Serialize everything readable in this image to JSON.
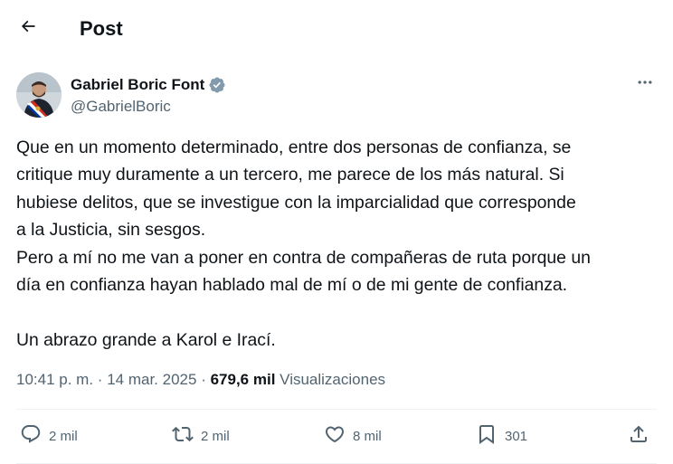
{
  "header": {
    "title": "Post",
    "back_icon": "arrow-left-icon"
  },
  "author": {
    "name": "Gabriel Boric Font",
    "handle": "@GabrielBoric",
    "verified_icon": "verified-badge-icon",
    "verified_color": "#829aab"
  },
  "post": {
    "lines": [
      "Que en un momento determinado, entre dos personas de confianza, se",
      "critique muy duramente a un tercero, me parece de los más natural. Si",
      "hubiese delitos, que se investigue con la imparcialidad que corresponde",
      "a la Justicia, sin sesgos.",
      "Pero a mí no me van a poner en contra de compañeras de ruta porque un",
      "día en confianza hayan hablado mal de mí o de mi gente de confianza.",
      "",
      "Un abrazo grande a Karol e Irací."
    ]
  },
  "meta": {
    "time": "10:41 p. m.",
    "separator": "·",
    "date": "14 mar. 2025",
    "views_count": "679,6 mil",
    "views_label": "Visualizaciones"
  },
  "actions": {
    "replies": "2 mil",
    "reposts": "2 mil",
    "likes": "8 mil",
    "bookmarks": "301"
  },
  "colors": {
    "text": "#0f1419",
    "secondary": "#536471",
    "divider": "#eff3f4"
  }
}
